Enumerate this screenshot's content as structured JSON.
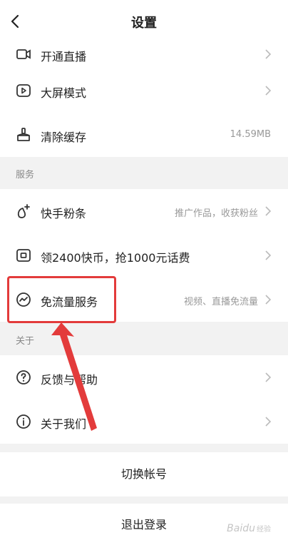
{
  "header": {
    "title": "设置"
  },
  "rows": [
    {
      "label": "开通直播",
      "hint": ""
    },
    {
      "label": "大屏模式",
      "hint": ""
    },
    {
      "label": "清除缓存",
      "hint": "14.59MB"
    },
    {
      "label": "快手粉条",
      "hint": "推广作品，收获粉丝"
    },
    {
      "label": "领2400快币，抢1000元话费",
      "hint": ""
    },
    {
      "label": "免流量服务",
      "hint": "视频、直播免流量"
    },
    {
      "label": "反馈与帮助",
      "hint": ""
    },
    {
      "label": "关于我们",
      "hint": ""
    }
  ],
  "sections": {
    "services": "服务",
    "about": "关于"
  },
  "actions": {
    "switch_account": "切换帐号",
    "logout": "退出登录"
  },
  "watermark": {
    "text": "Baidu",
    "sub": "经验"
  },
  "colors": {
    "highlight": "#e33b3b",
    "text": "#222222",
    "hint": "#999999"
  }
}
